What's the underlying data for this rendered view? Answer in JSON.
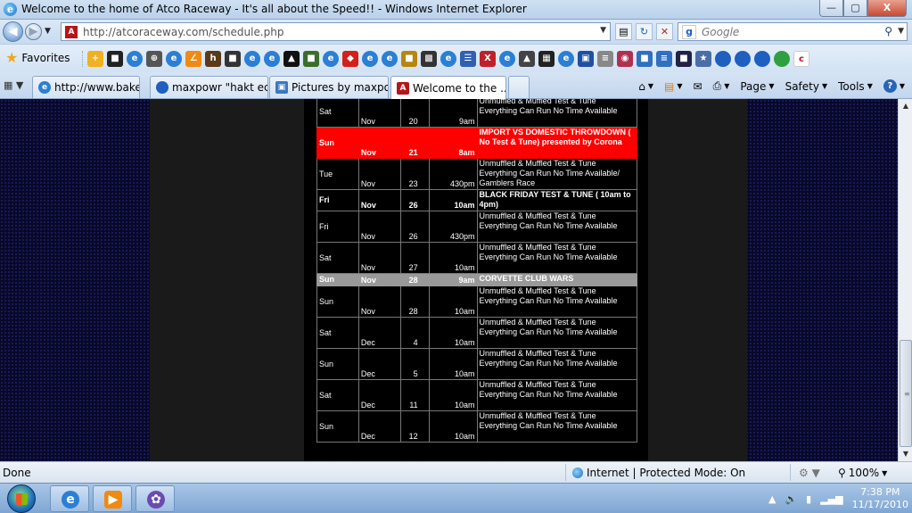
{
  "window": {
    "title": "Welcome to the home of Atco Raceway - It's all about the Speed!! - Windows Internet Explorer",
    "buttons": {
      "minimize": "—",
      "maximize": "▢",
      "close": "X"
    }
  },
  "address_bar": {
    "url": "http://atcoraceway.com/schedule.php",
    "search_placeholder": "Google"
  },
  "favorites_bar": {
    "favorites_label": "Favorites"
  },
  "tabs": [
    {
      "label": "http://www.bakemo...",
      "active": false
    },
    {
      "label": "maxpowr \"hakt ecu\"...",
      "active": false
    },
    {
      "label": "Pictures by maxpow...",
      "active": false
    },
    {
      "label": "Welcome to the ...",
      "active": true
    }
  ],
  "command_bar": {
    "page": "Page",
    "safety": "Safety",
    "tools": "Tools"
  },
  "schedule": [
    {
      "day": "Sat",
      "month": "Nov",
      "date": "20",
      "time": "9am",
      "desc": "Unmuffled & Muffled Test & Tune Everything Can Run  No Time Available",
      "style": "normal"
    },
    {
      "day": "Sun",
      "month": "Nov",
      "date": "21",
      "time": "8am",
      "desc": "IMPORT VS DOMESTIC THROWDOWN ( No Test & Tune) presented by Corona",
      "style": "red"
    },
    {
      "day": "Tue",
      "month": "Nov",
      "date": "23",
      "time": "430pm",
      "desc": "Unmuffled & Muffled Test & Tune Everything Can Run  No Time Available/ Gamblers Race",
      "style": "normal"
    },
    {
      "day": "Fri",
      "month": "Nov",
      "date": "26",
      "time": "10am",
      "desc": "BLACK FRIDAY TEST & TUNE ( 10am to 4pm)",
      "style": "bold"
    },
    {
      "day": "Fri",
      "month": "Nov",
      "date": "26",
      "time": "430pm",
      "desc": "Unmuffled & Muffled Test & Tune Everything Can Run  No Time Available",
      "style": "normal"
    },
    {
      "day": "Sat",
      "month": "Nov",
      "date": "27",
      "time": "10am",
      "desc": "Unmuffled & Muffled Test & Tune Everything Can Run  No Time Available",
      "style": "normal"
    },
    {
      "day": "Sun",
      "month": "Nov",
      "date": "28",
      "time": "9am",
      "desc": "CORVETTE CLUB WARS",
      "style": "gray"
    },
    {
      "day": "Sun",
      "month": "Nov",
      "date": "28",
      "time": "10am",
      "desc": "Unmuffled & Muffled Test & Tune Everything Can Run  No Time Available",
      "style": "normal"
    },
    {
      "day": "Sat",
      "month": "Dec",
      "date": "4",
      "time": "10am",
      "desc": "Unmuffled & Muffled Test & Tune Everything Can Run  No Time Available",
      "style": "normal"
    },
    {
      "day": "Sun",
      "month": "Dec",
      "date": "5",
      "time": "10am",
      "desc": "Unmuffled & Muffled Test & Tune Everything Can Run  No Time Available",
      "style": "normal"
    },
    {
      "day": "Sat",
      "month": "Dec",
      "date": "11",
      "time": "10am",
      "desc": "Unmuffled & Muffled Test & Tune Everything Can Run  No Time Available",
      "style": "normal"
    },
    {
      "day": "Sun",
      "month": "Dec",
      "date": "12",
      "time": "10am",
      "desc": "Unmuffled & Muffled Test & Tune Everything Can Run  No Time Available",
      "style": "normal"
    }
  ],
  "status_bar": {
    "status": "Done",
    "zone": "Internet | Protected Mode: On",
    "zoom": "100%"
  },
  "taskbar": {
    "time": "7:38 PM",
    "date": "11/17/2010"
  },
  "colors": {
    "highlight_red": "#ff0000",
    "highlight_gray": "#999999",
    "page_bg": "#08082a"
  }
}
